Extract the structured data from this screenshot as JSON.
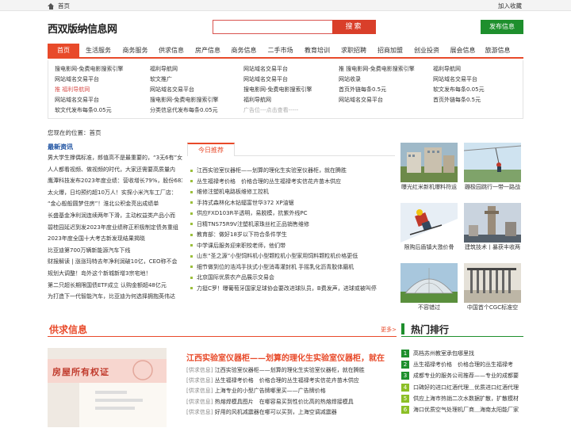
{
  "topbar": {
    "home": "首页",
    "favorite": "加入收藏"
  },
  "header": {
    "logo": "西双版纳信息网",
    "search_placeholder": "",
    "search_button": "搜索",
    "publish_button": "发布信息"
  },
  "nav": {
    "items": [
      "首页",
      "生活服务",
      "商务服务",
      "供求信息",
      "房产信息",
      "商务信息",
      "二手市场",
      "教育培训",
      "求职招聘",
      "招商加盟",
      "创业投资",
      "展会信息",
      "旅游信息"
    ],
    "active": 0
  },
  "links": {
    "columns": [
      [
        "搜电影网-免费电影搜索引擎",
        "网站域名交易平台",
        "推 福利导航网",
        "网站域名交易平台",
        "软文代发布每条0.05元"
      ],
      [
        "福利导航网",
        "软文推广",
        "网站域名交易平台",
        "搜电影网-免费电影搜索引擎",
        "分类信息代发布每条0.05元"
      ],
      [
        "网站域名交易平台",
        "网站域名交易平台",
        "搜电影网-免费电影搜索引擎",
        "福利导航网",
        "广告位---点击查看-----"
      ],
      [
        "推 搜电影网-免费电影搜索引擎",
        "网站收录",
        "首页外链每条0.5元",
        "网站域名交易平台"
      ],
      [
        "福利导航网",
        "网站域名交易平台",
        "软文发布每条0.05元",
        "首页外链每条0.5元"
      ]
    ]
  },
  "breadcrumb": "您现在的位置：首页",
  "latest": {
    "title": "最新资讯",
    "items": [
      "男大学生撑偶标准，郎值高不是最重要的，“3无6有”女",
      "人人都看视频、做视频的时代，大家还需要高质量内",
      "鹰潭科技发布2023年度业绩：营收增长79%，股份683",
      "太火爆，日均预约超10万人！实探小米汽车工厂店：",
      "“金心般般圆梦住房”！淮北公积金亮出成绩单",
      "长盛基金净利润连续两年下滑，主动权益类产品小而",
      "碧桂园延迟到发2023年度业绩称正积极制定债务重组",
      "2023年度全国十大考古新发现结果揭晓",
      "比亚迪第700万辆新能源汽车下线",
      "财报解读 | 涨涨玛特去年净利润破10亿，CEO称不会",
      "规划大调整！岛外这个新城新增3宗宅地！",
      "第二只超长期限国债ETF成立 认购金额超48亿元",
      "为打造下一代智能汽车，比亚迪为何选择拥抱英伟达"
    ]
  },
  "today": {
    "tab": "今日推荐",
    "items": [
      "江西实验室仪器柜——划算的理化生实验室仪器柜，就在腾胜",
      "丛生福禄考价格　价格合理的丛生福禄考实信花卉苗木供应",
      "维修注塑机电路板维修工控机",
      "手持式森林化木钻辐富世华372 XP油锯",
      "供应FXD103R半透明，易脱模，抗紫外线PC",
      "日精TNS75R9V注塑机滚珠丝杠正品销售维修",
      "教育部：做好18岁以下符合条件学生",
      "中学课后服务迎来职校老师，他们带",
      "山东“圣之源”小型饲料机小型颗粒机小型家用饲料颗粒机价格更低",
      "细节做到位的浩鸿手扶式小型消毒灌封机 手摇乳化沥青胶体磨机",
      "北京国际优质农产品展示交易会",
      "力挺C罗！曝葡萄牙国家足球协会要改进球队员，B费发声，进球或被叫停"
    ]
  },
  "pictures": [
    {
      "caption": "曝光红米新机爆料符运"
    },
    {
      "caption": "蹦极园跳行一带一路战"
    },
    {
      "caption": "限购后盾镇大激价骨"
    },
    {
      "caption": "建筑技术丨暴获丰收两"
    },
    {
      "caption": "不容错过"
    },
    {
      "caption": "中国首个CGC标准空"
    }
  ],
  "supply": {
    "title": "供求信息",
    "more": "更多>",
    "image_text": "房屋所有权证",
    "headline": "江西实验室仪器柜——划算的理化生实验室仪器柜，就在",
    "rows": [
      {
        "tag": "[供求信息]",
        "text": "江西实验室仪器柜——划算的理化生实验室仪器柜，就在腾胜"
      },
      {
        "tag": "[供求信息]",
        "text": "丛生福禄考价格　价格合理的丛生福禄考实信花卉苗木供应"
      },
      {
        "tag": "[供求信息]",
        "text": "上海专业的小型广告牌哪里买——广告牌价格"
      },
      {
        "tag": "[供求信息]",
        "text": "热熔焊模具图片　在哪容易买到性价比高的热熔焊接模具"
      },
      {
        "tag": "[供求信息]",
        "text": "好用的风机减震器在哪可以买到，上海空调减震器"
      }
    ]
  },
  "rank": {
    "title": "热门排行",
    "items": [
      "高档苏州教室承包哪里找",
      "丛生福禄考价格　价格合理的丛生福禄考",
      "成都专业的服务公司推荐——专业的成都要",
      "口碑好的进口红酒代理＿优质进口红酒代理",
      "供应上海市热销二次水数据扩散，扩散模材",
      "海口优质空气处理机厂商＿海南太阳能厂家"
    ]
  },
  "colors": {
    "accent": "#e84a2a",
    "green": "#1e8f2d",
    "blue": "#1a4fa0"
  }
}
